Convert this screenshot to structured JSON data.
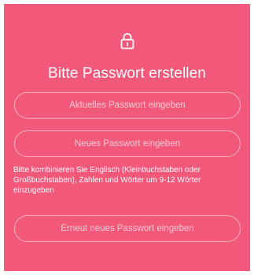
{
  "screen": {
    "title": "Bitte Passwort erstellen",
    "lock_icon": "lock-icon",
    "background_color": "#f2587a"
  },
  "fields": {
    "current_password": {
      "placeholder": "Aktuelles Passwort eingeben",
      "value": ""
    },
    "new_password": {
      "placeholder": "Neues Passwort eingeben",
      "value": ""
    },
    "repeat_password": {
      "placeholder": "Erneut neues Passwort eingeben",
      "value": ""
    }
  },
  "hint": {
    "text": "Bitte kombinieren Sie Englisch (Kleinbuchstaben oder Großbuchstaben), Zahlen und Wörter um 9-12 Wörter einzugeben"
  }
}
